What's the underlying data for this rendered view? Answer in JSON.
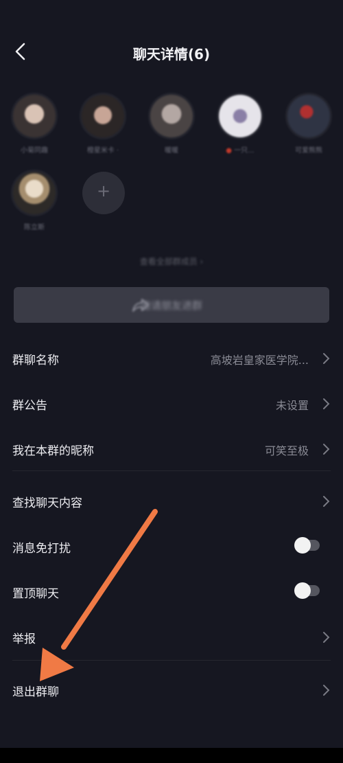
{
  "header": {
    "title": "聊天详情(6)"
  },
  "members": [
    {
      "name": "小菊同趣",
      "color": "#b89b8d"
    },
    {
      "name": "橙星米卡 ·",
      "color": "#8e6a5c"
    },
    {
      "name": "暖暖",
      "color": "#9b8e8a"
    },
    {
      "name": "一只...",
      "color": "#c8c4cf"
    },
    {
      "name": "可爱熊熊",
      "color": "#5a5f6f"
    },
    {
      "name": "陈立斯",
      "color": "#c9b9a4"
    }
  ],
  "view_all": "查看全部群成员 ›",
  "share_button": "邀请朋友进群",
  "settings": [
    {
      "label": "群聊名称",
      "value": "高坡岩皇家医学院...",
      "chevron": true
    },
    {
      "label": "群公告",
      "value": "未设置",
      "chevron": true
    },
    {
      "label": "我在本群的昵称",
      "value": "可笑至极",
      "chevron": true
    },
    {
      "label": "查找聊天内容",
      "value": "",
      "chevron": true
    },
    {
      "label": "消息免打扰",
      "toggle": false
    },
    {
      "label": "置顶聊天",
      "toggle": false
    },
    {
      "label": "举报",
      "value": "",
      "chevron": true
    },
    {
      "label": "退出群聊",
      "value": "",
      "chevron": true
    }
  ],
  "colors": {
    "background": "#161721",
    "annotation_arrow": "#f07a45",
    "divider": "#26272f"
  }
}
